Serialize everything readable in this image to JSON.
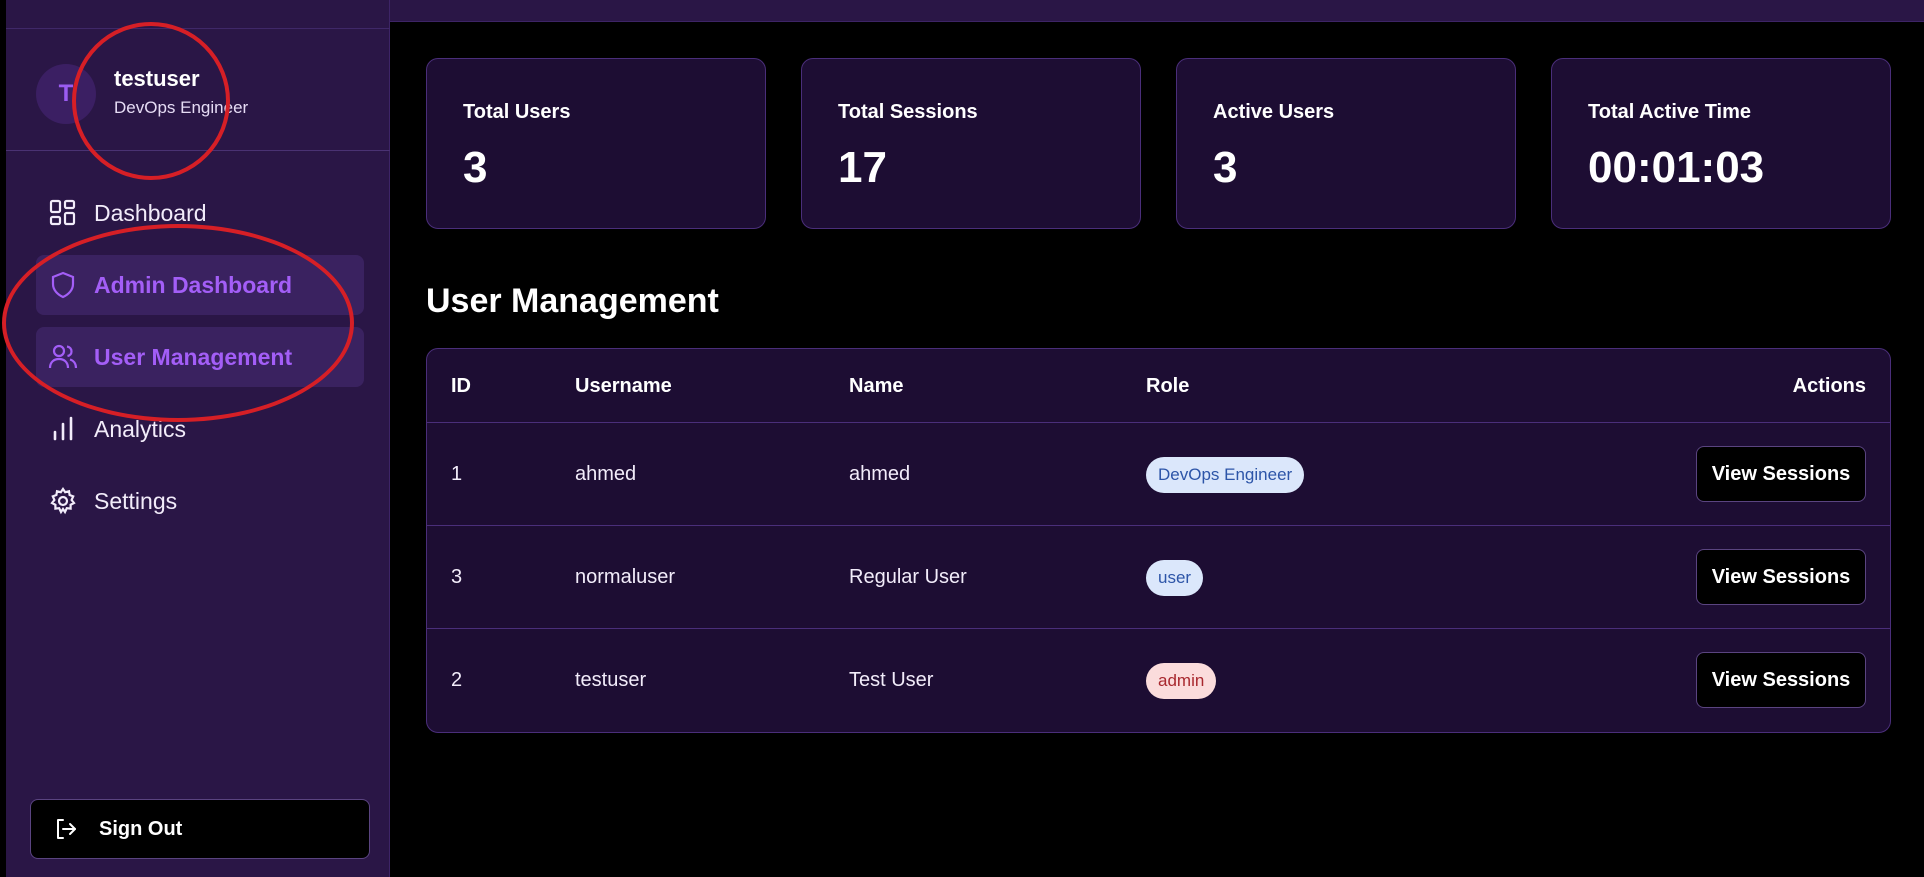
{
  "profile": {
    "avatar_letter": "T",
    "name": "testuser",
    "role": "DevOps Engineer"
  },
  "nav": {
    "items": [
      {
        "label": "Dashboard",
        "icon": "grid-icon",
        "active": false
      },
      {
        "label": "Admin Dashboard",
        "icon": "shield-icon",
        "active": true
      },
      {
        "label": "User Management",
        "icon": "users-icon",
        "active": true
      },
      {
        "label": "Analytics",
        "icon": "bar-chart-icon",
        "active": false
      },
      {
        "label": "Settings",
        "icon": "gear-icon",
        "active": false
      }
    ]
  },
  "signout": {
    "label": "Sign Out",
    "icon": "logout-icon"
  },
  "stats": [
    {
      "title": "Total Users",
      "value": "3"
    },
    {
      "title": "Total Sessions",
      "value": "17"
    },
    {
      "title": "Active Users",
      "value": "3"
    },
    {
      "title": "Total Active Time",
      "value": "00:01:03"
    }
  ],
  "user_management": {
    "title": "User Management",
    "columns": [
      "ID",
      "Username",
      "Name",
      "Role",
      "Actions"
    ],
    "rows": [
      {
        "id": "1",
        "username": "ahmed",
        "name": "ahmed",
        "role": "DevOps Engineer",
        "action": "View Sessions"
      },
      {
        "id": "3",
        "username": "normaluser",
        "name": "Regular User",
        "role": "user",
        "action": "View Sessions"
      },
      {
        "id": "2",
        "username": "testuser",
        "name": "Test User",
        "role": "admin",
        "action": "View Sessions"
      }
    ]
  },
  "colors": {
    "sidebar_bg": "#2a1646",
    "accent": "#a35ef7",
    "card_bg": "#1d0d33",
    "annotation": "#d61f26"
  }
}
